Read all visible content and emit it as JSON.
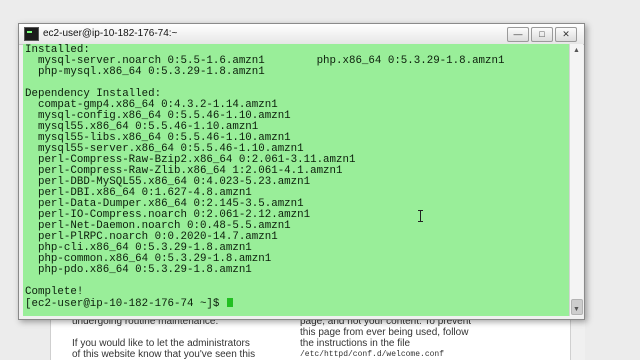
{
  "window": {
    "title": "ec2-user@ip-10-182-176-74:~",
    "icon": "terminal-icon",
    "controls": {
      "minimize": "—",
      "maximize": "□",
      "close": "✕"
    }
  },
  "terminal": {
    "lines": [
      "Installed:",
      "  mysql-server.noarch 0:5.5-1.6.amzn1        php.x86_64 0:5.3.29-1.8.amzn1",
      "  php-mysql.x86_64 0:5.3.29-1.8.amzn1",
      "",
      "Dependency Installed:",
      "  compat-gmp4.x86_64 0:4.3.2-1.14.amzn1",
      "  mysql-config.x86_64 0:5.5.46-1.10.amzn1",
      "  mysql55.x86_64 0:5.5.46-1.10.amzn1",
      "  mysql55-libs.x86_64 0:5.5.46-1.10.amzn1",
      "  mysql55-server.x86_64 0:5.5.46-1.10.amzn1",
      "  perl-Compress-Raw-Bzip2.x86_64 0:2.061-3.11.amzn1",
      "  perl-Compress-Raw-Zlib.x86_64 1:2.061-4.1.amzn1",
      "  perl-DBD-MySQL55.x86_64 0:4.023-5.23.amzn1",
      "  perl-DBI.x86_64 0:1.627-4.8.amzn1",
      "  perl-Data-Dumper.x86_64 0:2.145-3.5.amzn1",
      "  perl-IO-Compress.noarch 0:2.061-2.12.amzn1",
      "  perl-Net-Daemon.noarch 0:0.48-5.5.amzn1",
      "  perl-PlRPC.noarch 0:0.2020-14.7.amzn1",
      "  php-cli.x86_64 0:5.3.29-1.8.amzn1",
      "  php-common.x86_64 0:5.3.29-1.8.amzn1",
      "  php-pdo.x86_64 0:5.3.29-1.8.amzn1",
      "",
      "Complete!"
    ],
    "prompt": "[ec2-user@ip-10-182-176-74 ~]$ ",
    "background": "#99ee99",
    "cursor_color": "#21c021"
  },
  "background_page": {
    "left_text": [
      "undergoing routine maintenance.",
      "",
      "If you would like to let the administrators",
      "of this website know that you've seen this"
    ],
    "right_text": [
      "page, and not your content. To prevent",
      "this page from ever being used, follow",
      "the instructions in the file",
      "/etc/httpd/conf.d/welcome.conf"
    ]
  }
}
